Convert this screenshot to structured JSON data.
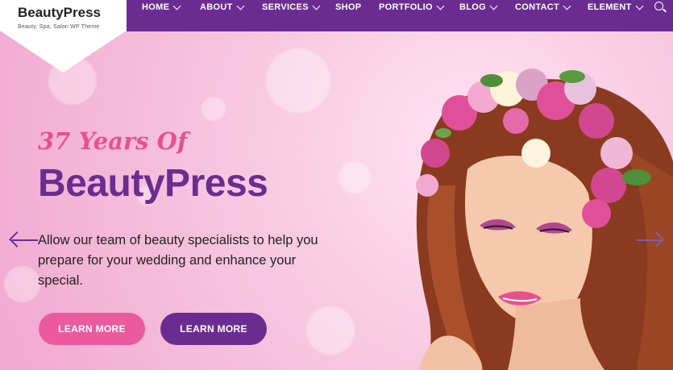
{
  "logo": {
    "title": "BeautyPress",
    "tagline": "Beauty, Spa, Salon WP Theme"
  },
  "nav": {
    "items": [
      {
        "label": "HOME",
        "dropdown": true
      },
      {
        "label": "ABOUT",
        "dropdown": true
      },
      {
        "label": "SERVICES",
        "dropdown": true
      },
      {
        "label": "SHOP",
        "dropdown": false
      },
      {
        "label": "PORTFOLIO",
        "dropdown": true
      },
      {
        "label": "BLOG",
        "dropdown": true
      },
      {
        "label": "CONTACT",
        "dropdown": true
      },
      {
        "label": "ELEMENT",
        "dropdown": true
      }
    ],
    "search_icon": "search-icon"
  },
  "hero": {
    "kicker": "37 Years Of",
    "headline": "BeautyPress",
    "description": "Allow our team of beauty specialists to help you prepare for your wedding and enhance your special.",
    "buttons": [
      {
        "label": "LEARN MORE",
        "color": "#ea5a9c"
      },
      {
        "label": "LEARN MORE",
        "color": "#6b2c91"
      }
    ],
    "prev_icon": "arrow-left-icon",
    "next_icon": "arrow-right-icon"
  },
  "colors": {
    "brand_purple": "#6b2c91",
    "accent_pink": "#ea5a9c",
    "kicker_pink": "#e8508d"
  }
}
